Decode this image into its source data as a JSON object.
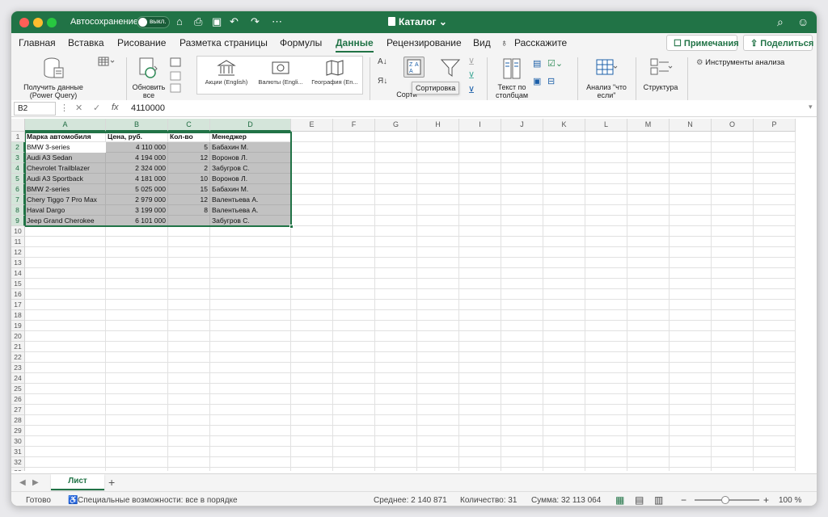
{
  "titlebar": {
    "autosave_label": "Автосохранение",
    "toggle_state": "выкл.",
    "document_title": "Каталог"
  },
  "menu": {
    "items": [
      "Главная",
      "Вставка",
      "Рисование",
      "Разметка страницы",
      "Формулы",
      "Данные",
      "Рецензирование",
      "Вид"
    ],
    "active": "Данные",
    "tell_me": "Расскажите",
    "comments_button": "Примечания",
    "share_button": "Поделиться"
  },
  "ribbon": {
    "get_data": "Получить данные (Power Query)",
    "refresh_all": "Обновить все",
    "gallery": [
      "Акции (English)",
      "Валюты (Engli...",
      "География (En..."
    ],
    "sort_label": "Сорти",
    "text_to_columns": "Текст по столбцам",
    "what_if": "Анализ \"что если\"",
    "outline": "Структура",
    "analysis_tools": "Инструменты анализа",
    "tooltip": "Сортировка"
  },
  "formula_bar": {
    "name_box": "B2",
    "fx": "fx",
    "value": "4110000"
  },
  "columns": [
    "A",
    "B",
    "C",
    "D",
    "E",
    "F",
    "G",
    "H",
    "I",
    "J",
    "K",
    "L",
    "M",
    "N",
    "O",
    "P"
  ],
  "sheet": {
    "headers": [
      "Марка автомобиля",
      "Цена, руб.",
      "Кол-во",
      "Менеджер"
    ],
    "rows": [
      [
        "BMW 3-series",
        "4 110 000",
        "5",
        "Бабахин М."
      ],
      [
        "Audi A3 Sedan",
        "4 194 000",
        "12",
        "Воронов Л."
      ],
      [
        "Chevrolet Trailblazer",
        "2 324 000",
        "2",
        "Забугров С."
      ],
      [
        "Audi A3 Sportback",
        "4 181 000",
        "10",
        "Воронов Л."
      ],
      [
        "BMW 2-series",
        "5 025 000",
        "15",
        "Бабахин М."
      ],
      [
        "Chery Tiggo 7 Pro Max",
        "2 979 000",
        "12",
        "Валентьева А."
      ],
      [
        "Haval Dargo",
        "3 199 000",
        "8",
        "Валентьева А."
      ],
      [
        "Jeep Grand Cherokee",
        "6 101 000",
        "",
        "Забугров С."
      ]
    ]
  },
  "sheet_tab": "Лист",
  "status": {
    "ready": "Готово",
    "accessibility": "Специальные возможности: все в порядке",
    "average": "Среднее: 2 140 871",
    "count": "Количество: 31",
    "sum": "Сумма: 32 113 064",
    "zoom": "100 %"
  }
}
